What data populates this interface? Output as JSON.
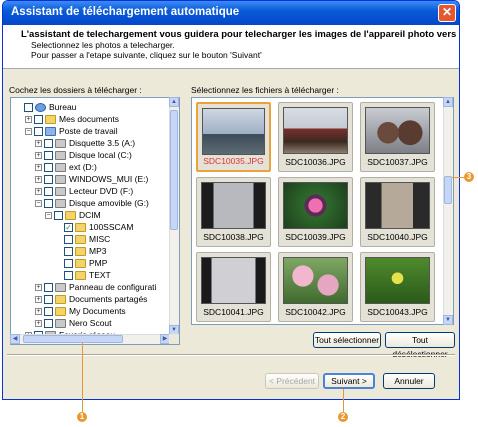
{
  "window": {
    "title": "Assistant de téléchargement automatique",
    "close": "✕",
    "header_title": "L'assistant de telechargement vous guidera pour telecharger les images de l'appareil photo vers le",
    "header_line1": "Selectionnez les photos a telecharger.",
    "header_line2": "Pour passer a l'etape suivante, cliquez sur le bouton 'Suivant'"
  },
  "left_label": "Cochez les dossiers à télécharger :",
  "right_label": "Sélectionnez les fichiers à télécharger :",
  "tree": [
    {
      "label": "Bureau",
      "icon": "desktop-icon",
      "pm": "",
      "cb": ""
    },
    {
      "label": "Mes documents",
      "icon": "folder-icon",
      "pm": "+",
      "cb": ""
    },
    {
      "label": "Poste de travail",
      "icon": "computer-icon",
      "pm": "−",
      "cb": ""
    },
    {
      "label": "Disquette 3.5 (A:)",
      "icon": "floppy-icon",
      "pm": "+",
      "cb": ""
    },
    {
      "label": "Disque local (C:)",
      "icon": "drive-icon",
      "pm": "+",
      "cb": ""
    },
    {
      "label": "ext (D:)",
      "icon": "drive-icon",
      "pm": "+",
      "cb": ""
    },
    {
      "label": "WINDOWS_MUI (E:)",
      "icon": "cd-icon",
      "pm": "+",
      "cb": ""
    },
    {
      "label": "Lecteur DVD (F:)",
      "icon": "dvd-icon",
      "pm": "+",
      "cb": ""
    },
    {
      "label": "Disque amovible (G:)",
      "icon": "drive-icon",
      "pm": "−",
      "cb": ""
    },
    {
      "label": "DCIM",
      "icon": "folder-icon",
      "pm": "−",
      "cb": ""
    },
    {
      "label": "100SSCAM",
      "icon": "folder-icon",
      "pm": "",
      "cb": "✓"
    },
    {
      "label": "MISC",
      "icon": "folder-icon",
      "pm": "",
      "cb": ""
    },
    {
      "label": "MP3",
      "icon": "folder-icon",
      "pm": "",
      "cb": ""
    },
    {
      "label": "PMP",
      "icon": "folder-icon",
      "pm": "",
      "cb": ""
    },
    {
      "label": "TEXT",
      "icon": "folder-icon",
      "pm": "",
      "cb": ""
    },
    {
      "label": "Panneau de configurati",
      "icon": "control-panel-icon",
      "pm": "+",
      "cb": ""
    },
    {
      "label": "Documents partagés",
      "icon": "folder-icon",
      "pm": "+",
      "cb": ""
    },
    {
      "label": "My Documents",
      "icon": "folder-icon",
      "pm": "+",
      "cb": ""
    },
    {
      "label": "Nero Scout",
      "icon": "nero-icon",
      "pm": "+",
      "cb": ""
    },
    {
      "label": "Favoris réseau",
      "icon": "network-icon",
      "pm": "+",
      "cb": ""
    }
  ],
  "files": [
    {
      "name": "SDC10035.JPG",
      "selected": true
    },
    {
      "name": "SDC10036.JPG",
      "selected": false
    },
    {
      "name": "SDC10037.JPG",
      "selected": false
    },
    {
      "name": "SDC10038.JPG",
      "selected": false
    },
    {
      "name": "SDC10039.JPG",
      "selected": false
    },
    {
      "name": "SDC10040.JPG",
      "selected": false
    },
    {
      "name": "SDC10041.JPG",
      "selected": false
    },
    {
      "name": "SDC10042.JPG",
      "selected": false
    },
    {
      "name": "SDC10043.JPG",
      "selected": false
    }
  ],
  "buttons": {
    "select_all": "Tout sélectionner",
    "deselect_all": "Tout désélectionner",
    "previous": "< Précédent",
    "next": "Suivant >",
    "cancel": "Annuler"
  },
  "callouts": {
    "c1": "1",
    "c2": "2",
    "c3": "3"
  },
  "colors": {
    "selection": "#e9a33a",
    "callout": "#e9982f",
    "title_bar": "#0a5bd9"
  }
}
